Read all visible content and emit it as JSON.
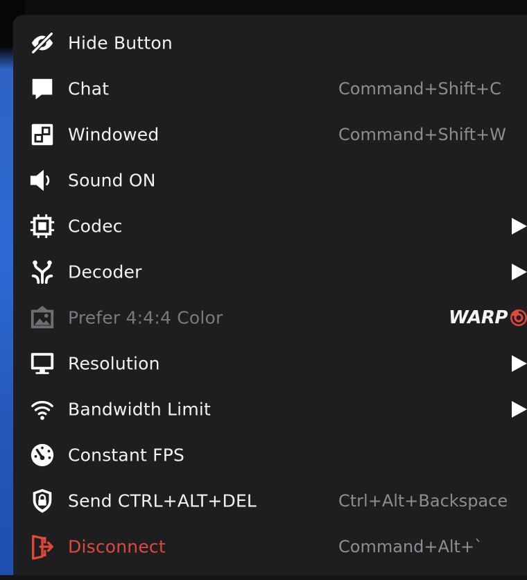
{
  "menu": {
    "items": [
      {
        "label": "Hide Button",
        "shortcut": "",
        "icon": "eye-slash-icon"
      },
      {
        "label": "Chat",
        "shortcut": "Command+Shift+C",
        "icon": "chat-bubble-icon"
      },
      {
        "label": "Windowed",
        "shortcut": "Command+Shift+W",
        "icon": "windowed-icon"
      },
      {
        "label": "Sound ON",
        "shortcut": "",
        "icon": "speaker-icon"
      },
      {
        "label": "Codec",
        "shortcut": "",
        "icon": "chip-icon",
        "submenu": true
      },
      {
        "label": "Decoder",
        "shortcut": "",
        "icon": "decoder-icon",
        "submenu": true
      },
      {
        "label": "Prefer 4:4:4 Color",
        "shortcut": "",
        "icon": "image-icon",
        "disabled": true,
        "badge": "WARP"
      },
      {
        "label": "Resolution",
        "shortcut": "",
        "icon": "monitor-icon",
        "submenu": true
      },
      {
        "label": "Bandwidth Limit",
        "shortcut": "",
        "icon": "wifi-icon",
        "submenu": true
      },
      {
        "label": "Constant FPS",
        "shortcut": "",
        "icon": "gauge-icon"
      },
      {
        "label": "Send CTRL+ALT+DEL",
        "shortcut": "Ctrl+Alt+Backspace",
        "icon": "lock-shield-icon"
      },
      {
        "label": "Disconnect",
        "shortcut": "Command+Alt+`",
        "icon": "exit-icon",
        "danger": true
      }
    ]
  },
  "colors": {
    "menu_bg": "#1e1e20",
    "text": "#f2f2f2",
    "shortcut": "#8d8d91",
    "disabled": "#7a7a7e",
    "danger": "#e0483a",
    "badge_swirl": "#e0483a"
  }
}
